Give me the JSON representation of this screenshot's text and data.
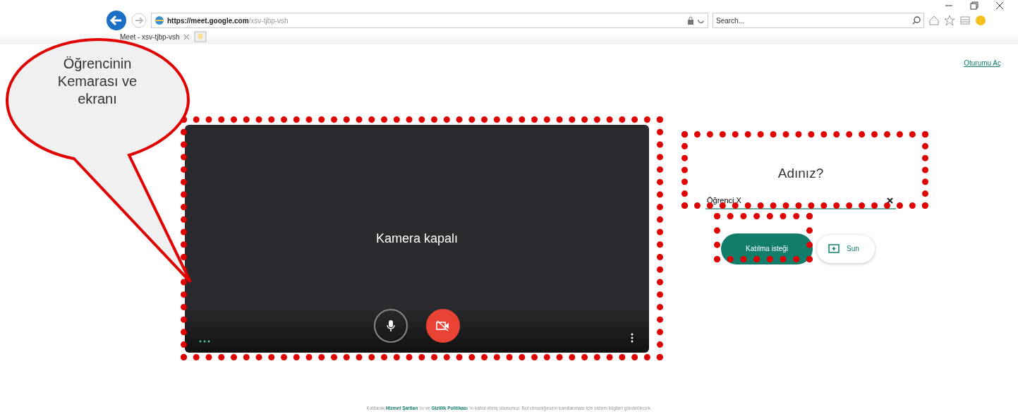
{
  "browser": {
    "url_host": "https://meet.google.com",
    "url_path": "/xsv-tjbp-vsh",
    "search_placeholder": "Search...",
    "tab_title": "Meet - xsv-tjbp-vsh"
  },
  "header": {
    "sign_in": "Oturumu Aç"
  },
  "video": {
    "status": "Kamera kapalı",
    "mic_muted": false,
    "camera_off": true
  },
  "join": {
    "title": "Adınız?",
    "name_value": "Öğrenci X",
    "join_button": "Katılma isteği",
    "present_button": "Sun"
  },
  "footer": [
    {
      "kind": "text",
      "text": "Katılarak "
    },
    {
      "kind": "link",
      "text": "Hizmet Şartları"
    },
    {
      "kind": "text",
      "text": " 'nı ve "
    },
    {
      "kind": "link",
      "text": "Gizlilik Politikası"
    },
    {
      "kind": "text",
      "text": " 'nı kabul etmiş olursunuz. Bot olmadığınızın kanıtlanması için sistem bilgileri gönderilecek."
    }
  ],
  "callout": {
    "text": "Öğrencinin Kemarası ve ekranı"
  }
}
